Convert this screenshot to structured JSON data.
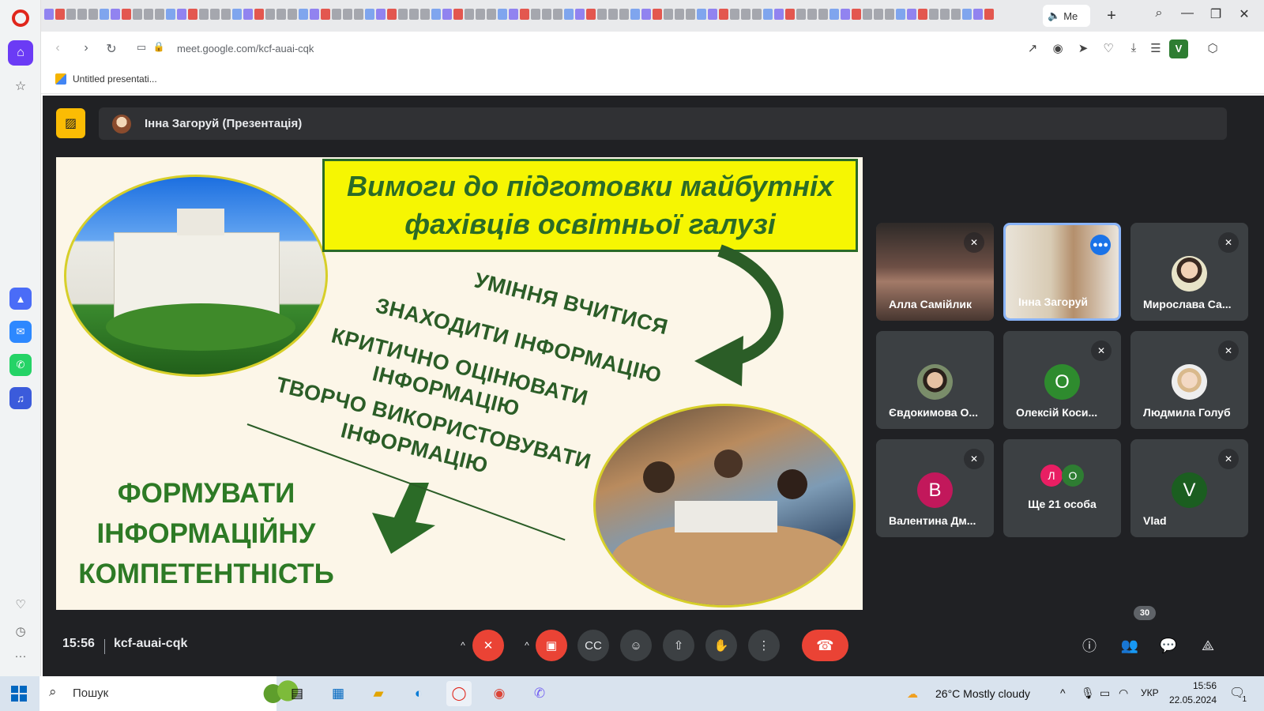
{
  "browser": {
    "url": "meet.google.com/kcf-auai-cqk",
    "active_tab_label": "Me",
    "bookmark_label": "Untitled presentati...",
    "profile_initial": "V"
  },
  "meet": {
    "presenter_title": "Інна Загоруй (Презентація)",
    "clock": "15:56",
    "meeting_code": "kcf-auai-cqk",
    "participant_count": "30",
    "slide": {
      "title_line1": "Вимоги до підготовки майбутніх",
      "title_line2": "фахівців освітньої галузі",
      "skills": [
        "УМІННЯ ВЧИТИСЯ",
        "ЗНАХОДИТИ ІНФОРМАЦІЮ",
        "КРИТИЧНО ОЦІНЮВАТИ",
        "ІНФОРМАЦІЮ",
        "ТВОРЧО ВИКОРИСТОВУВАТИ",
        "ІНФОРМАЦІЮ"
      ],
      "goal_line1": "ФОРМУВАТИ",
      "goal_line2": "ІНФОРМАЦІЙНУ",
      "goal_line3": "КОМПЕТЕНТНІСТЬ"
    },
    "participants": [
      {
        "name": "Алла Самійлик"
      },
      {
        "name": "Інна Загоруй"
      },
      {
        "name": "Мирослава Са..."
      },
      {
        "name": "Євдокимова О..."
      },
      {
        "name": "Олексій Коси...",
        "initial": "О"
      },
      {
        "name": "Людмила Голуб"
      },
      {
        "name": "Валентина Дм...",
        "initial": "В"
      },
      {
        "more_label": "Ще 21 особа",
        "initial_a": "Л",
        "initial_b": "О"
      },
      {
        "name": "Vlad",
        "initial": "V"
      }
    ]
  },
  "taskbar": {
    "search_label": "Пошук",
    "weather": "26°C  Mostly cloudy",
    "language": "УКР",
    "time": "15:56",
    "date": "22.05.2024",
    "notifications": "1"
  },
  "colors": {
    "meet_bg": "#202124",
    "tile_bg": "#3c4043",
    "danger": "#ea4335",
    "speaking": "#8ab4f8",
    "slide_title_bg": "#f6f602",
    "slide_text": "#2b5d27"
  }
}
